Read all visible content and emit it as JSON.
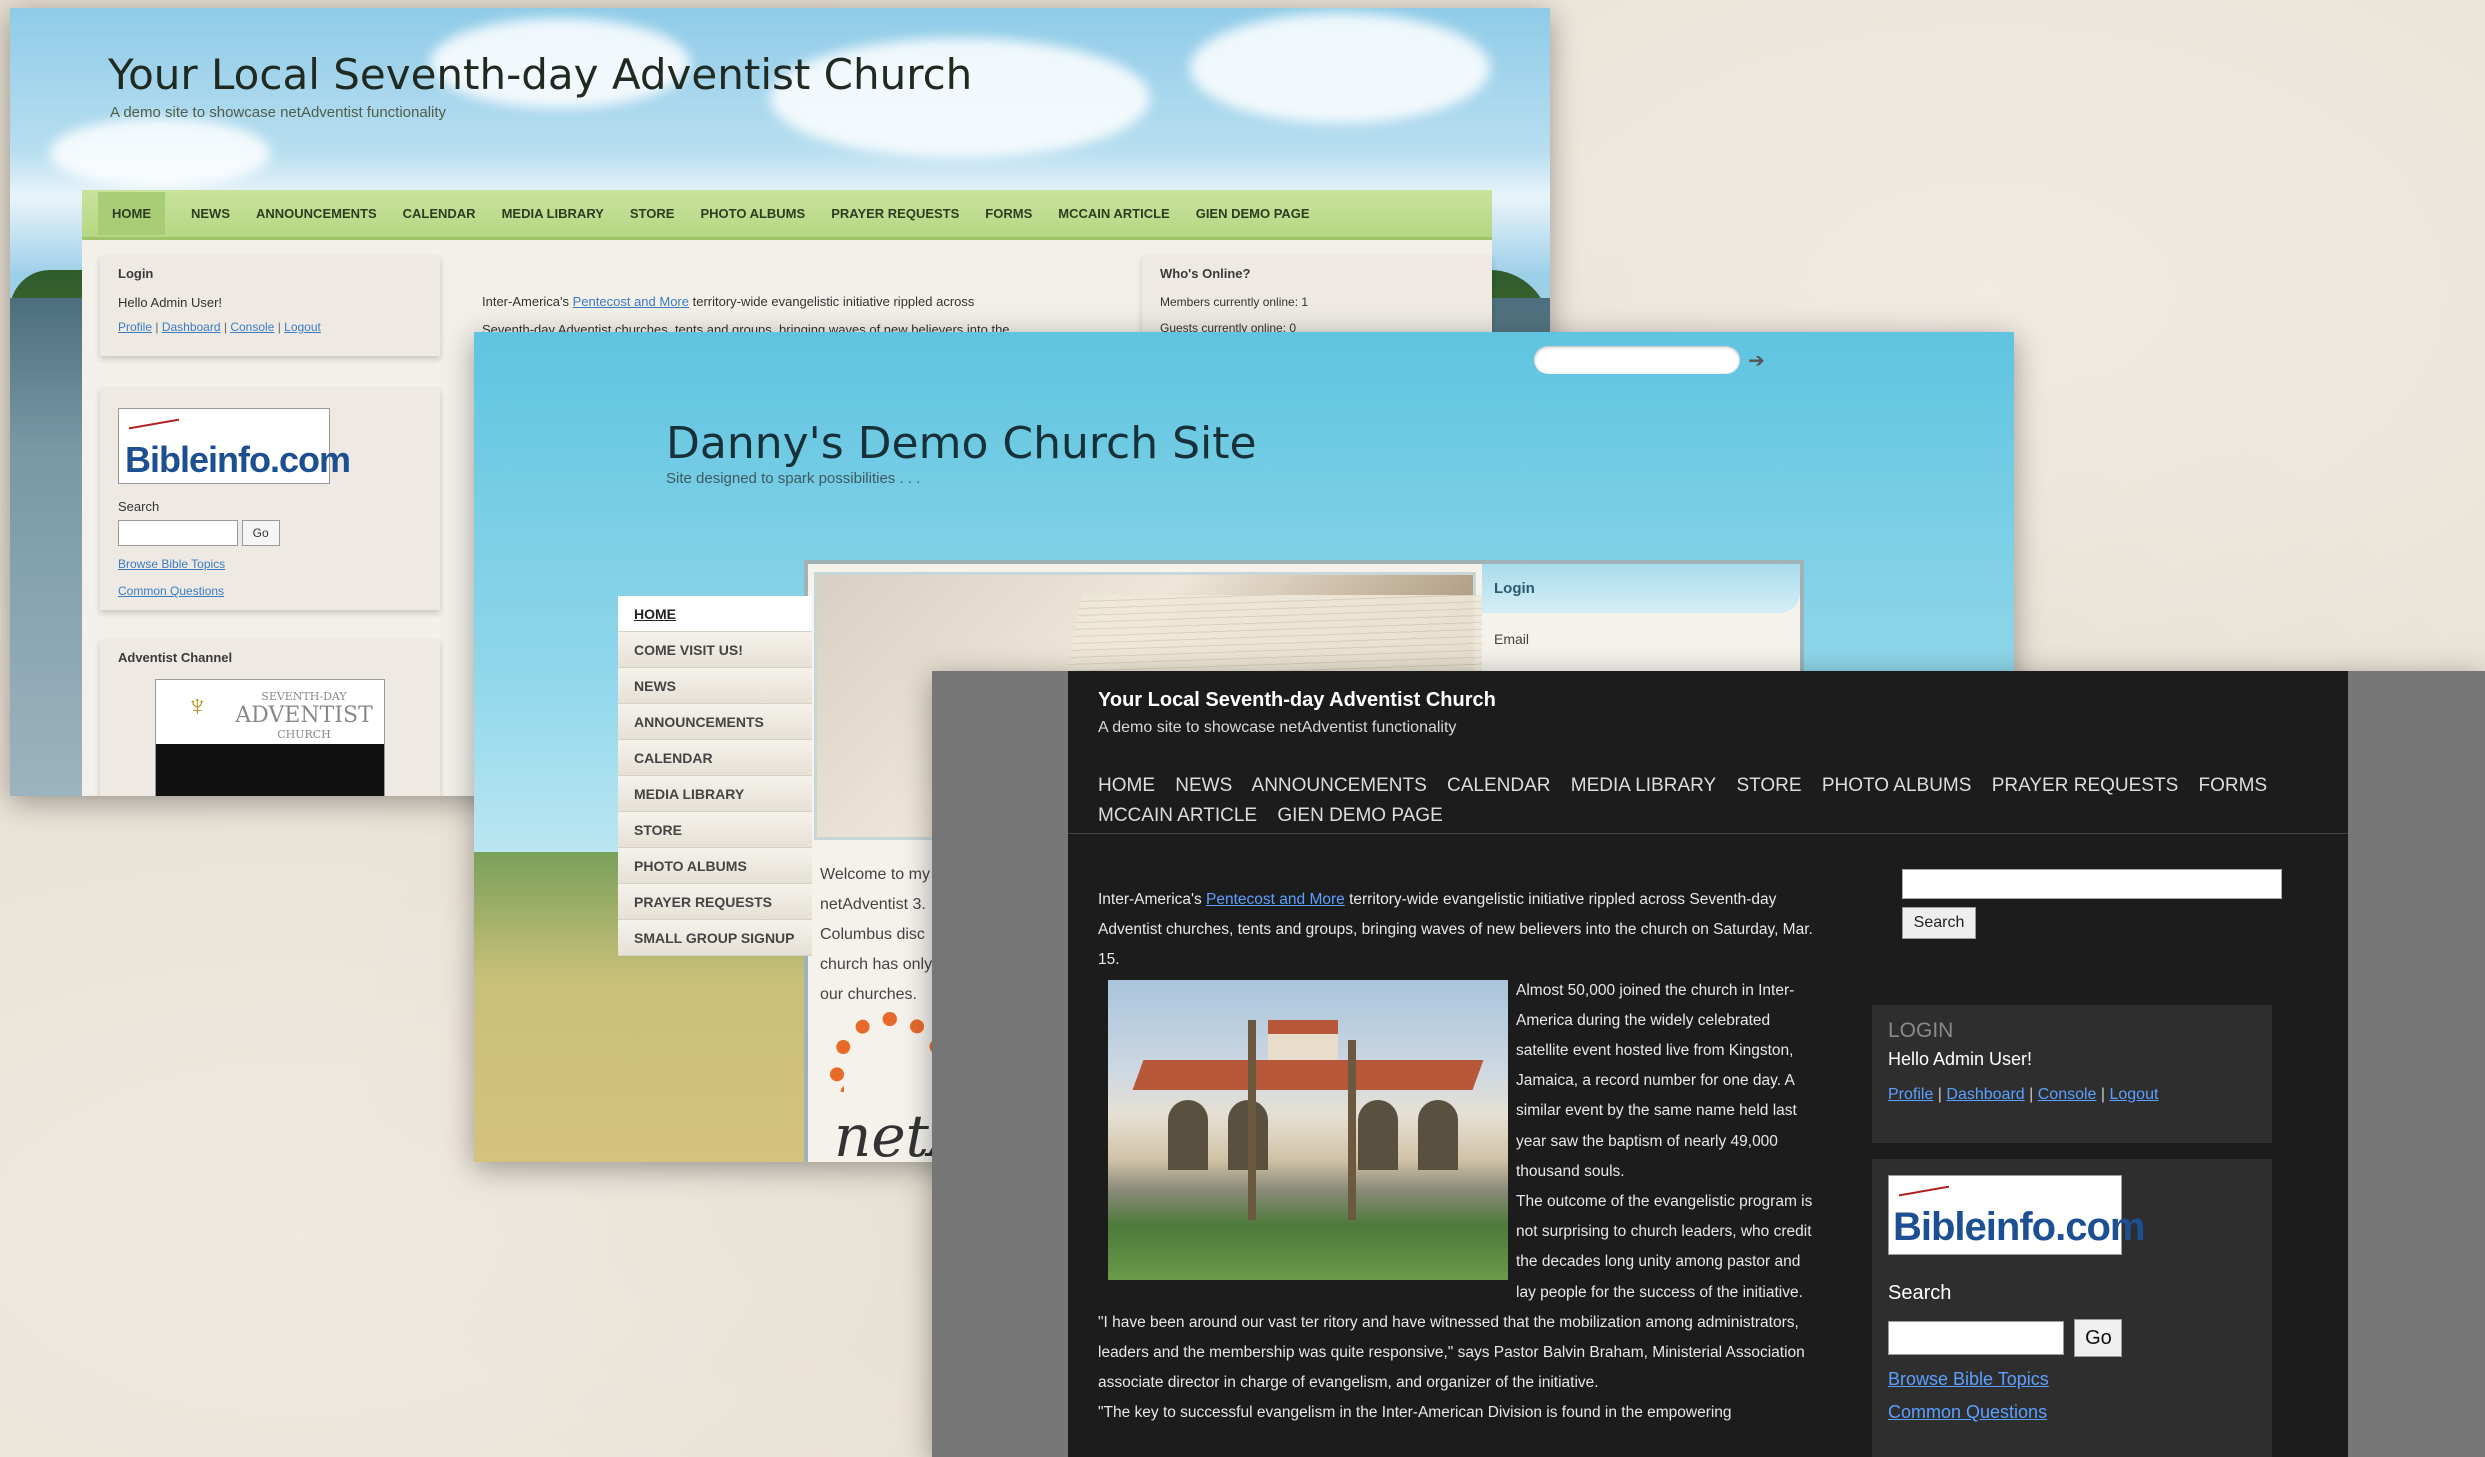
{
  "shot1": {
    "title": "Your Local Seventh-day Adventist Church",
    "tagline": "A demo site to showcase netAdventist functionality",
    "nav": [
      "HOME",
      "NEWS",
      "ANNOUNCEMENTS",
      "CALENDAR",
      "MEDIA LIBRARY",
      "STORE",
      "PHOTO ALBUMS",
      "PRAYER REQUESTS",
      "FORMS",
      "MCCAIN ARTICLE",
      "GIEN DEMO PAGE"
    ],
    "login": {
      "heading": "Login",
      "greeting": "Hello Admin User!",
      "links": [
        "Profile",
        "Dashboard",
        "Console",
        "Logout"
      ]
    },
    "bible": {
      "logo": "Bibleinfo.com",
      "search_label": "Search",
      "go": "Go",
      "link1": "Browse Bible Topics",
      "link2": "Common Questions"
    },
    "channel": {
      "heading": "Adventist Channel",
      "logo_line1": "SEVENTH-DAY",
      "logo_line2": "ADVENTIST",
      "logo_line3": "CHURCH"
    },
    "content": {
      "pre": "Inter-America's",
      "link": "Pentecost and More",
      "post": "territory-wide evangelistic initiative rippled across",
      "line2": "Seventh-day Adventist churches, tents and groups, bringing waves of new believers into the"
    },
    "online": {
      "heading": "Who's Online?",
      "members": "Members currently online: 1",
      "guests": "Guests currently online: 0"
    }
  },
  "shot2": {
    "title": "Danny's Demo Church Site",
    "tagline": "Site designed to spark possibilities . . .",
    "menu": [
      "HOME",
      "COME VISIT US!",
      "NEWS",
      "ANNOUNCEMENTS",
      "CALENDAR",
      "MEDIA LIBRARY",
      "STORE",
      "PHOTO ALBUMS",
      "PRAYER REQUESTS",
      "SMALL GROUP SIGNUP"
    ],
    "login_heading": "Login",
    "email_label": "Email",
    "welcome": [
      "Welcome to my",
      "netAdventist 3.",
      "Columbus disc",
      "church has only",
      "our churches."
    ],
    "net_logo": "netA"
  },
  "shot3": {
    "title": "Your Local Seventh-day Adventist Church",
    "tagline": "A demo site to showcase netAdventist functionality",
    "nav": [
      "HOME",
      "NEWS",
      "ANNOUNCEMENTS",
      "CALENDAR",
      "MEDIA LIBRARY",
      "STORE",
      "PHOTO ALBUMS",
      "PRAYER REQUESTS",
      "FORMS",
      "MCCAIN ARTICLE",
      "GIEN DEMO PAGE"
    ],
    "search_button": "Search",
    "article": {
      "pre": "Inter-America's",
      "link": "Pentecost and More",
      "post": "territory-wide evangelistic initiative rippled across Seventh-day Adventist churches, tents and groups, bringing waves of new believers into the church on Saturday, Mar. 15.",
      "p2": "Almost 50,000 joined the church in Inter-America during the widely celebrated satellite event hosted live from Kingston, Jamaica, a record number for one day. A similar event by the same name held last year saw the baptism of nearly 49,000 thousand souls.",
      "p3": "The outcome of the evangelistic program is not surprising to church leaders, who credit the decades long unity among pastor and lay people for the success of the initiative.",
      "p4": "\"I have been around our vast ter ritory and have witnessed that the mobilization among administrators, leaders and the membership was quite responsive,\" says Pastor Balvin Braham, Ministerial Association associate director in charge of evangelism, and organizer of the initiative.",
      "p5": "\"The key to successful evangelism in the Inter-American Division is found in the empowering"
    },
    "login": {
      "heading": "LOGIN",
      "greeting": "Hello Admin User!",
      "links": [
        "Profile",
        "Dashboard",
        "Console",
        "Logout"
      ]
    },
    "bible": {
      "logo": "Bibleinfo.com",
      "search_label": "Search",
      "go": "Go",
      "link1": "Browse Bible Topics",
      "link2": "Common Questions"
    }
  }
}
